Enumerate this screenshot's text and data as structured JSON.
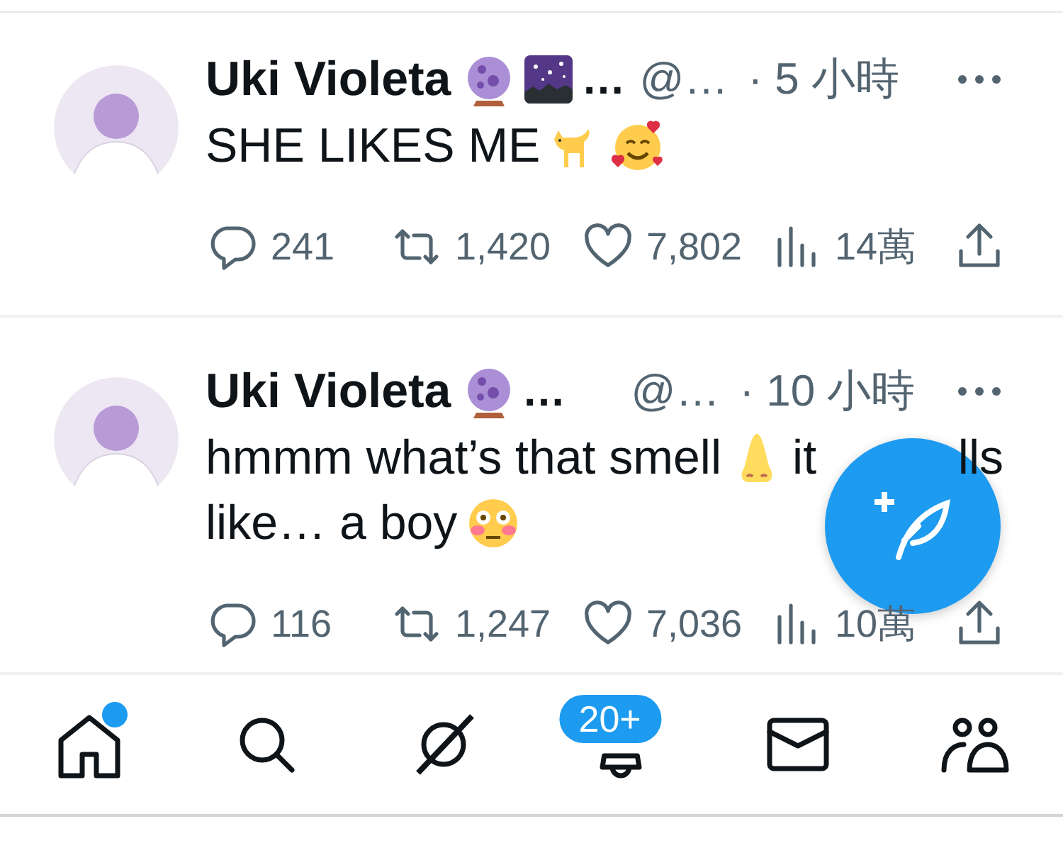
{
  "tweets": [
    {
      "name": "Uki Violeta",
      "badges": [
        {
          "kind": "orb"
        },
        {
          "kind": "galaxy"
        }
      ],
      "name_cut": "…",
      "handle": "@…",
      "time": "· 5 小時",
      "body": [
        {
          "kind": "text",
          "text": "SHE LIKES ME"
        },
        {
          "kind": "cat"
        },
        {
          "kind": "hearts"
        }
      ],
      "replies": "241",
      "reposts": "1,420",
      "likes": "7,802",
      "views": "14萬"
    },
    {
      "name": "Uki Violeta",
      "badges": [
        {
          "kind": "orb"
        }
      ],
      "name_cut": "…",
      "handle": "@…",
      "time": "· 10 小時",
      "body": [
        {
          "kind": "text",
          "text": "hmmm what’s that smell"
        },
        {
          "kind": "nose"
        },
        {
          "kind": "text",
          "text": "it"
        },
        {
          "kind": "gap"
        },
        {
          "kind": "text",
          "text": "lls"
        },
        {
          "kind": "break"
        },
        {
          "kind": "text",
          "text": "like… a boy"
        },
        {
          "kind": "flushed"
        }
      ],
      "replies": "116",
      "reposts": "1,247",
      "likes": "7,036",
      "views": "10萬"
    }
  ],
  "nav": [
    {
      "kind": "home",
      "unread": true
    },
    {
      "kind": "search",
      "unread": false
    },
    {
      "kind": "grok",
      "unread": false
    },
    {
      "kind": "notifications",
      "unread": false,
      "badge": "20+"
    },
    {
      "kind": "messages",
      "unread": false
    },
    {
      "kind": "communities",
      "unread": false
    }
  ]
}
